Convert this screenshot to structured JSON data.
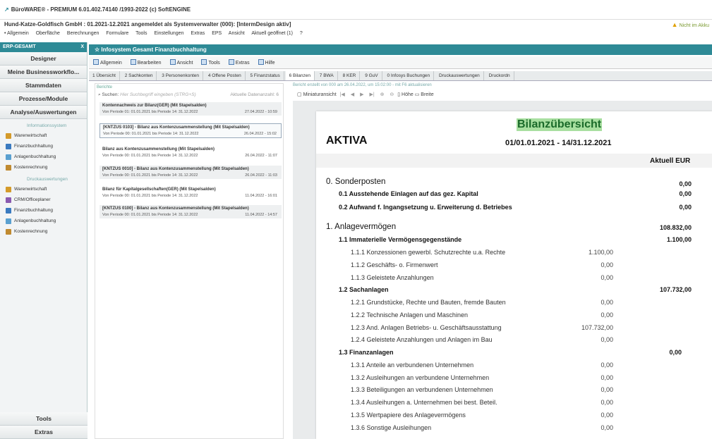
{
  "window": {
    "title": "BüroWARE® - PREMIUM  6.01.402.74140 /1993-2022 (c) SoftENGINE"
  },
  "infobar": {
    "text": "Hund-Katze-Goldfisch GmbH : 01.2021-12.2021 angemeldet als Systemverwalter (000): [IntermDesign aktiv]",
    "warning": "Nicht im Akku"
  },
  "menu": [
    "• Allgemein",
    "Oberfläche",
    "Berechnungen",
    "Formulare",
    "Tools",
    "Einstellungen",
    "Extras",
    "EPS",
    "Ansicht",
    "Aktuell geöffnet (1)",
    "?"
  ],
  "sidebar": {
    "header": "ERP-GESAMT",
    "close": "X",
    "buttons": [
      "Designer",
      "Meine Businessworkflo...",
      "Stammdaten",
      "Prozesse/Module",
      "Analyse/Auswertungen"
    ],
    "section1": "Informationssystem",
    "items1": [
      "Warenwirtschaft",
      "Finanzbuchhaltung",
      "Anlagenbuchhaltung",
      "Kostenrechnung"
    ],
    "section2": "Druckauswertungen",
    "items2": [
      "Warenwirtschaft",
      "CRM/Officeplaner",
      "Finanzbuchhaltung",
      "Anlagenbuchhaltung",
      "Kostenrechnung"
    ],
    "bottom": [
      "Tools",
      "Extras"
    ]
  },
  "main": {
    "header": "Infosystem Gesamt Finanzbuchhaltung",
    "toolbar": [
      "Allgemein",
      "Bearbeiten",
      "Ansicht",
      "Tools",
      "Extras",
      "Hilfe"
    ],
    "tabs": [
      "1 Übersicht",
      "2 Sachkonten",
      "3 Personenkonten",
      "4 Offene Posten",
      "5 Finanzstatus",
      "6 Bilanzen",
      "7 BWA",
      "8 KER",
      "9 GuV",
      "0 Infosys Buchungen",
      "Druckauswertungen",
      "Druckordn"
    ],
    "active_tab": "6 Bilanzen"
  },
  "list": {
    "label": "Berichte",
    "search_label": "Suchen:",
    "search_placeholder": "Hier Suchbegriff eingeben (STRG+S)",
    "search_right": "Aktuelle Datenanzahl: 6",
    "items": [
      {
        "title": "Kontennachweis zur Bilanz(GER) (Mit Stapelsalden)",
        "sub": "Von Periode 01: 01.01.2021 bis Periode 14: 31.12.2022",
        "date": "27.04.2022 - 10:59"
      },
      {
        "title": "[KNTZUS 0103] - Bilanz aus Kontenzusammenstellung (Mit Stapelsalden)",
        "sub": "Von Periode 00: 01.01.2021 bis Periode 14: 31.12.2022",
        "date": "26.04.2022 - 15:02"
      },
      {
        "title": "Bilanz aus Kontenzusammenstellung (Mit Stapelsalden)",
        "sub": "Von Periode 00: 01.01.2021 bis Periode 14: 31.12.2022",
        "date": "26.04.2022 - 11:07"
      },
      {
        "title": "[KNTZUS 0010] - Bilanz aus Kontenzusammenstellung (Mit Stapelsalden)",
        "sub": "Von Periode 00: 01.01.2021 bis Periode 14: 31.12.2022",
        "date": "26.04.2022 - 11:03"
      },
      {
        "title": "Bilanz für Kapitalgesellschaften(GER) (Mit Stapelsalden)",
        "sub": "Von Periode 00: 01.01.2021 bis Periode 14: 31.12.2022",
        "date": "11.04.2022 - 16:01"
      },
      {
        "title": "[KNTZUS 0100] - Bilanz aus Kontenzusammenstellung (Mit Stapelsalden)",
        "sub": "Von Periode 00: 01.01.2021 bis Periode 14: 31.12.2022",
        "date": "11.04.2022 - 14:57"
      }
    ]
  },
  "report": {
    "info": "Bericht erstellt von 000 am 26.04.2022, um 15:02:00 - mit F6 aktualisieren",
    "tool_mini": "Miniaturansicht",
    "tool_height": "Höhe",
    "tool_width": "Breite",
    "title": "Bilanzübersicht",
    "side": "AKTIVA",
    "period": "01/01.01.2021 - 14/31.12.2021",
    "column": "Aktuell EUR",
    "rows": [
      {
        "label": "0. Sonderposten",
        "total": "0,00"
      },
      {
        "label": "0.1 Ausstehende Einlagen auf das gez. Kapital",
        "total": "0,00"
      },
      {
        "label": "0.2 Aufwand f. Ingangsetzung u. Erweiterung d. Betriebes",
        "total": "0,00"
      },
      {
        "label": "1. Anlagevermögen",
        "total": "108.832,00"
      },
      {
        "label": "1.1 Immaterielle Vermögensgegenstände",
        "total": "1.100,00"
      },
      {
        "label": "1.1.1 Konzessionen gewerbl. Schutzrechte u.a. Rechte",
        "amount": "1.100,00"
      },
      {
        "label": "1.1.2 Geschäfts- o. Firmenwert",
        "amount": "0,00"
      },
      {
        "label": "1.1.3 Geleistete Anzahlungen",
        "amount": "0,00"
      },
      {
        "label": "1.2 Sachanlagen",
        "total": "107.732,00"
      },
      {
        "label": "1.2.1 Grundstücke, Rechte und Bauten, fremde Bauten",
        "amount": "0,00"
      },
      {
        "label": "1.2.2 Technische Anlagen und Maschinen",
        "amount": "0,00"
      },
      {
        "label": "1.2.3 And. Anlagen Betriebs- u. Geschäftsausstattung",
        "amount": "107.732,00"
      },
      {
        "label": "1.2.4 Geleistete Anzahlungen und Anlagen im Bau",
        "amount": "0,00"
      },
      {
        "label": "1.3 Finanzanlagen",
        "total": "0,00"
      },
      {
        "label": "1.3.1 Anteile an verbundenen Unternehmen",
        "amount": "0,00"
      },
      {
        "label": "1.3.2 Ausleihungen an verbundene Unternehmen",
        "amount": "0,00"
      },
      {
        "label": "1.3.3 Beteiligungen an verbundenen Unternehmen",
        "amount": "0,00"
      },
      {
        "label": "1.3.4 Ausleihungen a. Unternehmen bei best. Beteil.",
        "amount": "0,00"
      },
      {
        "label": "1.3.5 Wertpapiere des Anlagevermögens",
        "amount": "0,00"
      },
      {
        "label": "1.3.6 Sonstige Ausleihungen",
        "amount": "0,00"
      }
    ]
  }
}
